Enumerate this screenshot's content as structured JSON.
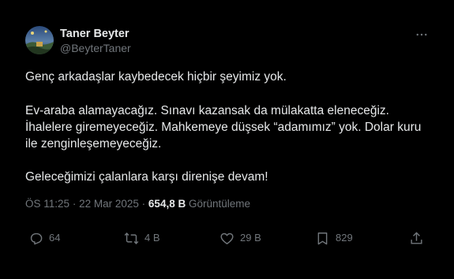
{
  "author": {
    "name": "Taner Beyter",
    "handle": "@BeyterTaner"
  },
  "tweet": {
    "lines": [
      "Genç arkadaşlar kaybedecek hiçbir şeyimiz yok.",
      "Ev-araba alamayacağız. Sınavı kazansak da mülakatta eleneceğiz.",
      "İhalelere giremeyeceğiz. Mahkemeye düşsek “adamımız” yok. Dolar kuru",
      "ile zenginleşemeyeceğiz.",
      "Geleceğimizi çalanlara karşı direnişe devam!"
    ]
  },
  "meta": {
    "time": "ÖS 11:25",
    "separator": "·",
    "date": "22 Mar 2025",
    "views": "654,8 B",
    "views_label": "Görüntüleme"
  },
  "actions": {
    "replies": "64",
    "reposts": "4 B",
    "likes": "29 B",
    "bookmarks": "829"
  },
  "colors": {
    "background": "#000000",
    "text": "#e7e9ea",
    "secondary": "#71767b"
  }
}
